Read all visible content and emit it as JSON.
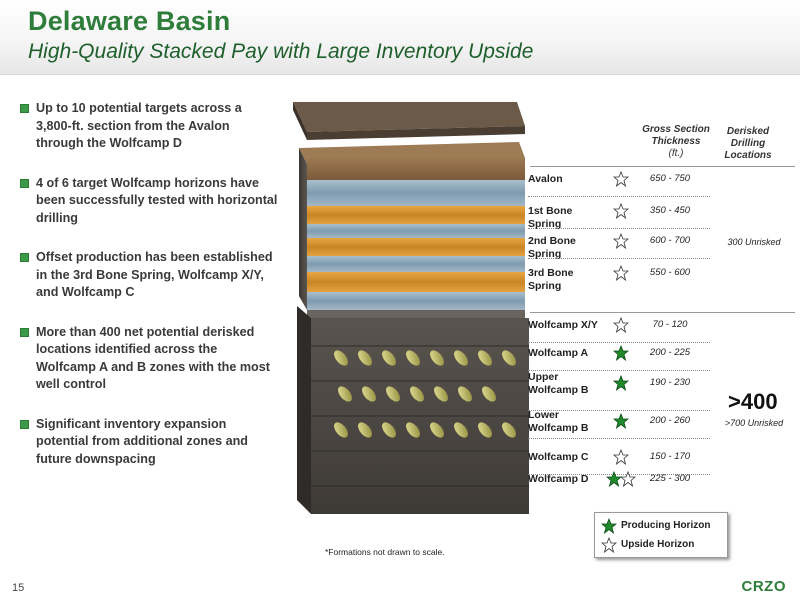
{
  "header": {
    "title": "Delaware Basin",
    "subtitle": "High-Quality Stacked Pay with Large Inventory Upside"
  },
  "bullets": [
    "Up to 10 potential targets across a 3,800-ft. section from the Avalon through the Wolfcamp D",
    "4 of 6 target Wolfcamp horizons have been successfully tested with horizontal drilling",
    "Offset production has been established in the 3rd Bone Spring, Wolfcamp X/Y, and Wolfcamp C",
    "More than 400 net potential derisked locations identified across the Wolfcamp A and B zones with the most well control",
    "Significant inventory expansion potential from additional zones and future downspacing"
  ],
  "table": {
    "col_thickness": "Gross Section Thickness",
    "col_thickness_unit": "(ft.)",
    "col_locations": "Derisked Drilling Locations",
    "rows": [
      {
        "name": "Avalon",
        "thickness": "650 - 750",
        "stars": [
          "upside"
        ]
      },
      {
        "name": "1st Bone Spring",
        "thickness": "350 - 450",
        "stars": [
          "upside"
        ]
      },
      {
        "name": "2nd Bone Spring",
        "thickness": "600 - 700",
        "stars": [
          "upside"
        ]
      },
      {
        "name": "3rd Bone Spring",
        "thickness": "550 - 600",
        "stars": [
          "upside"
        ]
      },
      {
        "name": "Wolfcamp X/Y",
        "thickness": "70 - 120",
        "stars": [
          "upside"
        ]
      },
      {
        "name": "Wolfcamp A",
        "thickness": "200 - 225",
        "stars": [
          "producing"
        ]
      },
      {
        "name": "Upper Wolfcamp B",
        "thickness": "190 - 230",
        "stars": [
          "producing"
        ]
      },
      {
        "name": "Lower Wolfcamp B",
        "thickness": "200 - 260",
        "stars": [
          "producing"
        ]
      },
      {
        "name": "Wolfcamp C",
        "thickness": "150 - 170",
        "stars": [
          "upside"
        ]
      },
      {
        "name": "Wolfcamp D",
        "thickness": "225 - 300",
        "stars": [
          "producing",
          "upside"
        ]
      }
    ],
    "upper_locations": "300 Unrisked",
    "lower_big": ">400",
    "lower_locations": ">700 Unrisked"
  },
  "legend": {
    "producing": "Producing Horizon",
    "upside": "Upside Horizon"
  },
  "note": "*Formations not drawn to scale.",
  "page_number": "15",
  "logo": "CRZO",
  "colors": {
    "title_green": "#2e7d3a",
    "star_green": "#1f8a2c",
    "sand_orange": "#d9932e",
    "shale_blue": "#8aa6b8"
  }
}
